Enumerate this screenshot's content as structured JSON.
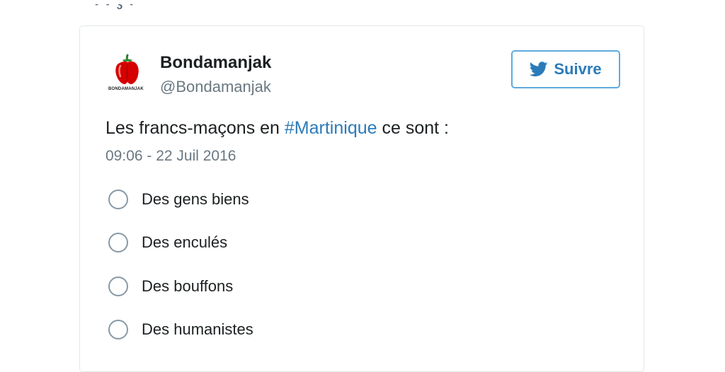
{
  "tweet": {
    "author": {
      "display_name": "Bondamanjak",
      "handle": "@Bondamanjak",
      "avatar_icon": "red-pepper-icon",
      "logo_text": "BONDAMANJAK"
    },
    "follow_button": {
      "label": "Suivre",
      "icon": "twitter-bird-icon"
    },
    "text_before": "Les francs-maçons en ",
    "hashtag": "#Martinique",
    "text_after": " ce sont :",
    "timestamp": "09:06 - 22 Juil 2016",
    "poll": {
      "options": [
        "Des gens biens",
        "Des enculés",
        "Des bouffons",
        "Des humanistes"
      ]
    }
  },
  "colors": {
    "link": "#2b7bb9",
    "follow_border": "#5eaade",
    "text_primary": "#1c2022",
    "text_secondary": "#697882",
    "radio_border": "#8899a6",
    "card_border": "#e1e8ed"
  }
}
